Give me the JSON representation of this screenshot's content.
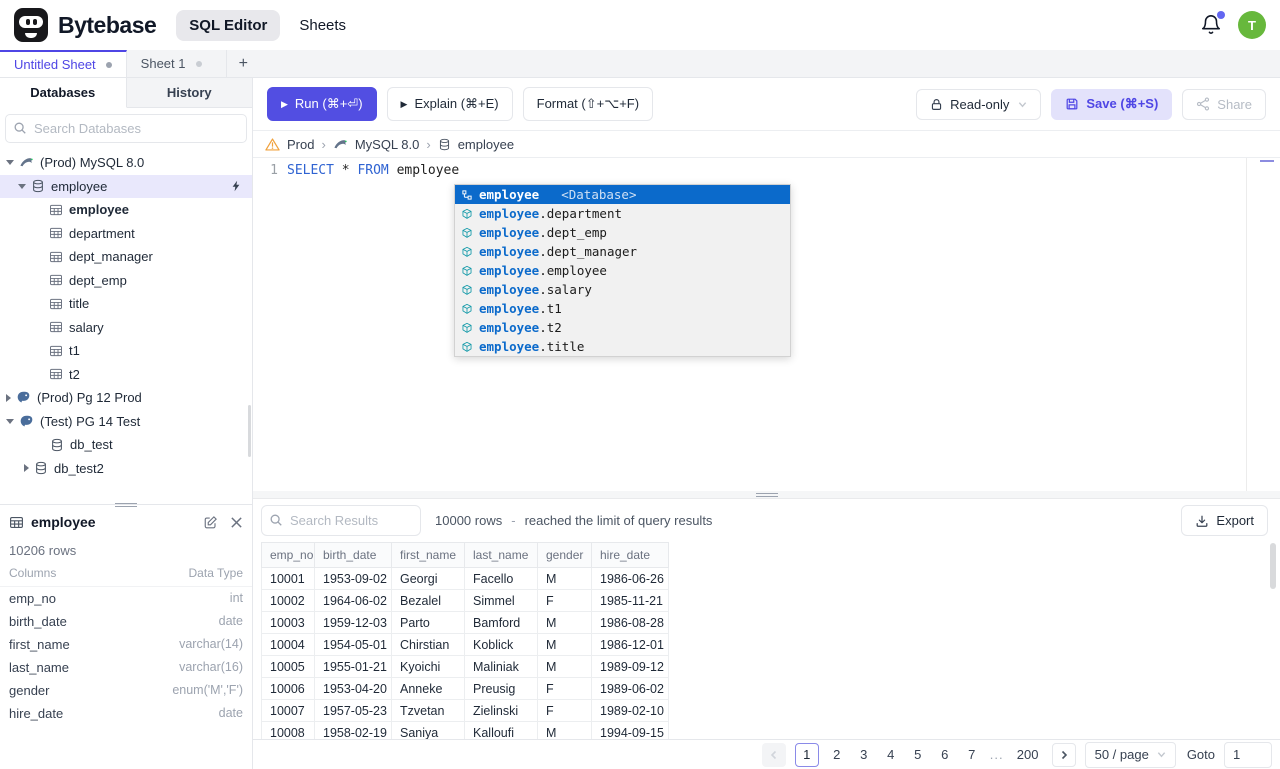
{
  "header": {
    "brand": "Bytebase",
    "nav_sql_editor": "SQL Editor",
    "nav_sheets": "Sheets",
    "avatar_initial": "T"
  },
  "sheet_tabs": {
    "tab1": "Untitled Sheet",
    "tab2": "Sheet 1",
    "add": "+"
  },
  "sidebar": {
    "tab_databases": "Databases",
    "tab_history": "History",
    "search_placeholder": "Search Databases",
    "mysql_group": "(Prod) MySQL 8.0",
    "employee_db": "employee",
    "tables": [
      {
        "label": "employee",
        "bold": true
      },
      {
        "label": "department"
      },
      {
        "label": "dept_manager"
      },
      {
        "label": "dept_emp"
      },
      {
        "label": "title"
      },
      {
        "label": "salary"
      },
      {
        "label": "t1"
      },
      {
        "label": "t2"
      }
    ],
    "pg_prod_group": "(Prod) Pg 12 Prod",
    "pg_test_group": "(Test) PG 14 Test",
    "db_test": "db_test",
    "db_test2": "db_test2"
  },
  "schema_panel": {
    "title": "employee",
    "rows_count": "10206 rows",
    "columns_label": "Columns",
    "datatype_label": "Data Type",
    "columns": [
      {
        "name": "emp_no",
        "type": "int"
      },
      {
        "name": "birth_date",
        "type": "date"
      },
      {
        "name": "first_name",
        "type": "varchar(14)"
      },
      {
        "name": "last_name",
        "type": "varchar(16)"
      },
      {
        "name": "gender",
        "type": "enum('M','F')"
      },
      {
        "name": "hire_date",
        "type": "date"
      }
    ]
  },
  "toolbar": {
    "run": "Run (⌘+⏎)",
    "explain": "Explain (⌘+E)",
    "format": "Format (⇧+⌥+F)",
    "readonly": "Read-only",
    "save": "Save (⌘+S)",
    "share": "Share"
  },
  "breadcrumb": {
    "env": "Prod",
    "instance": "MySQL 8.0",
    "database": "employee"
  },
  "editor": {
    "line_number": "1",
    "kw_select": "SELECT",
    "star": "*",
    "kw_from": "FROM",
    "table": "employee"
  },
  "suggest": {
    "selected_label": "employee",
    "selected_tag": "<Database>",
    "items": [
      {
        "prefix": "employee",
        "suffix": ".department"
      },
      {
        "prefix": "employee",
        "suffix": ".dept_emp"
      },
      {
        "prefix": "employee",
        "suffix": ".dept_manager"
      },
      {
        "prefix": "employee",
        "suffix": ".employee"
      },
      {
        "prefix": "employee",
        "suffix": ".salary"
      },
      {
        "prefix": "employee",
        "suffix": ".t1"
      },
      {
        "prefix": "employee",
        "suffix": ".t2"
      },
      {
        "prefix": "employee",
        "suffix": ".title"
      }
    ]
  },
  "results": {
    "search_placeholder": "Search Results",
    "row_count": "10000 rows",
    "dash": "-",
    "limit_note": "reached the limit of query results",
    "export_label": "Export",
    "headers": [
      "emp_no",
      "birth_date",
      "first_name",
      "last_name",
      "gender",
      "hire_date"
    ],
    "rows": [
      [
        "10001",
        "1953-09-02",
        "Georgi",
        "Facello",
        "M",
        "1986-06-26"
      ],
      [
        "10002",
        "1964-06-02",
        "Bezalel",
        "Simmel",
        "F",
        "1985-11-21"
      ],
      [
        "10003",
        "1959-12-03",
        "Parto",
        "Bamford",
        "M",
        "1986-08-28"
      ],
      [
        "10004",
        "1954-05-01",
        "Chirstian",
        "Koblick",
        "M",
        "1986-12-01"
      ],
      [
        "10005",
        "1955-01-21",
        "Kyoichi",
        "Maliniak",
        "M",
        "1989-09-12"
      ],
      [
        "10006",
        "1953-04-20",
        "Anneke",
        "Preusig",
        "F",
        "1989-06-02"
      ],
      [
        "10007",
        "1957-05-23",
        "Tzvetan",
        "Zielinski",
        "F",
        "1989-02-10"
      ],
      [
        "10008",
        "1958-02-19",
        "Saniya",
        "Kalloufi",
        "M",
        "1994-09-15"
      ]
    ]
  },
  "pagination": {
    "current": "1",
    "pages": [
      "2",
      "3",
      "4",
      "5",
      "6",
      "7"
    ],
    "ellipsis": "...",
    "last": "200",
    "page_size": "50 / page",
    "goto_label": "Goto",
    "goto_value": "1"
  },
  "colors": {
    "accent_indigo": "#4f46e5",
    "run_button": "#524ee2",
    "save_button_bg": "#e3e2fb",
    "tree_active_bg": "#e9e8fc",
    "suggest_selected_bg": "#0b6acb",
    "sql_keyword": "#2f63d2",
    "avatar_green": "#67b83c",
    "warning_amber": "#f0a13c"
  },
  "icons": {
    "search": "magnifier",
    "bell": "notification-bell",
    "mysql": "dolphin",
    "postgres": "elephant",
    "database": "cylinder",
    "table": "grid",
    "bolt": "lightning",
    "warning": "triangle-exclamation",
    "lock": "padlock",
    "save": "floppy-disk",
    "share": "share-nodes",
    "export": "download-tray",
    "edit": "pencil-square",
    "close": "x-mark",
    "cube": "table-suggestion-cube"
  }
}
